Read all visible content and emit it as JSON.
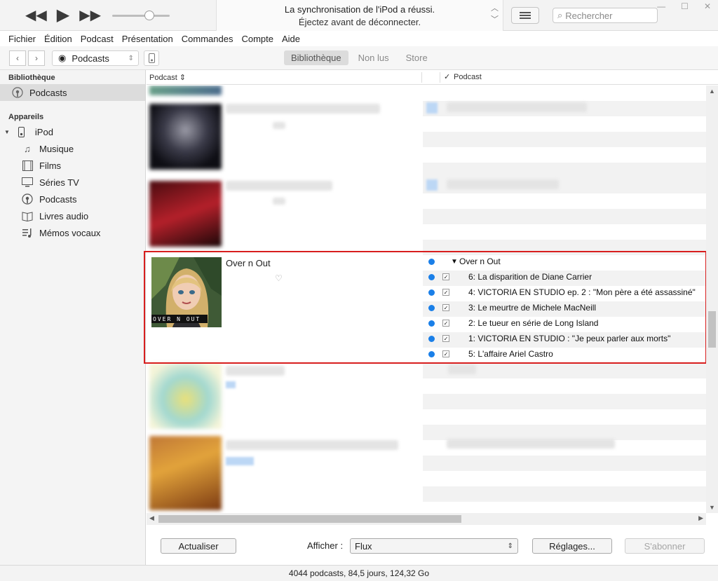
{
  "player": {
    "prev_icon": "rewind-icon",
    "play_icon": "play-icon",
    "next_icon": "fast-forward-icon",
    "status_line1": "La synchronisation de l'iPod a réussi.",
    "status_line2": "Éjectez avant de déconnecter.",
    "search_placeholder": "Rechercher"
  },
  "menu": [
    "Fichier",
    "Édition",
    "Podcast",
    "Présentation",
    "Commandes",
    "Compte",
    "Aide"
  ],
  "nav": {
    "media_kind": "Podcasts",
    "tabs": [
      "Bibliothèque",
      "Non lus",
      "Store"
    ]
  },
  "sidebar": {
    "library_title": "Bibliothèque",
    "library_items": [
      {
        "label": "Podcasts",
        "icon": "podcast-icon",
        "selected": true
      }
    ],
    "devices_title": "Appareils",
    "device": {
      "label": "iPod",
      "icon": "ipod-icon"
    },
    "device_items": [
      {
        "label": "Musique",
        "icon": "music-note-icon"
      },
      {
        "label": "Films",
        "icon": "film-icon"
      },
      {
        "label": "Séries TV",
        "icon": "tv-icon"
      },
      {
        "label": "Podcasts",
        "icon": "podcast-icon"
      },
      {
        "label": "Livres audio",
        "icon": "audiobook-icon"
      },
      {
        "label": "Mémos vocaux",
        "icon": "voice-memo-icon"
      }
    ]
  },
  "columns": {
    "left": "Podcast",
    "check": "✓",
    "right": "Podcast"
  },
  "podcast": {
    "title": "Over n Out",
    "artwork_caption": "OVER N OUT",
    "episodes_header": "Over n Out",
    "episodes": [
      "6: La disparition de Diane Carrier",
      "4: VICTORIA EN STUDIO ep. 2 : \"Mon père a été assassiné\"",
      "3: Le meurtre de Michele MacNeill",
      "2: Le tueur en série de Long Island",
      "1: VICTORIA EN STUDIO : \"Je peux parler aux morts\"",
      "5: L'affaire Ariel Castro"
    ]
  },
  "bottom": {
    "refresh_label": "Actualiser",
    "show_label": "Afficher :",
    "show_value": "Flux",
    "settings_label": "Réglages...",
    "subscribe_label": "S'abonner"
  },
  "status": "4044 podcasts, 84,5 jours, 124,32 Go",
  "colors": {
    "accent_blue": "#1a7fe8",
    "highlight_red": "#d81e1e"
  }
}
